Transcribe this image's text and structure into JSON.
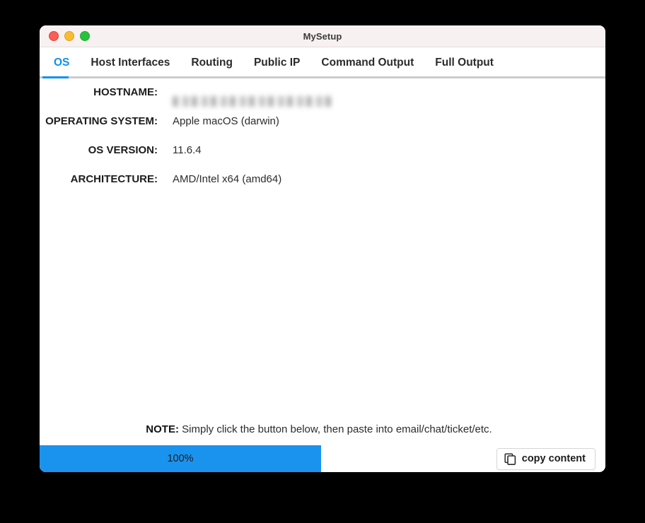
{
  "window": {
    "title": "MySetup",
    "traffic_lights": [
      "close",
      "minimize",
      "maximize"
    ]
  },
  "tabs": [
    {
      "label": "OS",
      "active": true
    },
    {
      "label": "Host Interfaces",
      "active": false
    },
    {
      "label": "Routing",
      "active": false
    },
    {
      "label": "Public IP",
      "active": false
    },
    {
      "label": "Command Output",
      "active": false
    },
    {
      "label": "Full Output",
      "active": false
    }
  ],
  "os_info": [
    {
      "label": "HOSTNAME:",
      "value": "",
      "redacted": true
    },
    {
      "label": "OPERATING SYSTEM:",
      "value": "Apple macOS (darwin)",
      "redacted": false
    },
    {
      "label": "OS VERSION:",
      "value": "11.6.4",
      "redacted": false
    },
    {
      "label": "ARCHITECTURE:",
      "value": "AMD/Intel x64 (amd64)",
      "redacted": false
    }
  ],
  "note": {
    "prefix": "NOTE:",
    "text": "Simply click the button below, then paste into email/chat/ticket/etc."
  },
  "bottom": {
    "progress_label": "100%",
    "progress_percent": 100,
    "copy_button_label": "copy content",
    "copy_icon": "copy-icon"
  },
  "colors": {
    "accent": "#0a91f2",
    "progress_bar": "#1a93ef",
    "titlebar": "#f7f1f1",
    "tab_rule": "#cccccc"
  }
}
